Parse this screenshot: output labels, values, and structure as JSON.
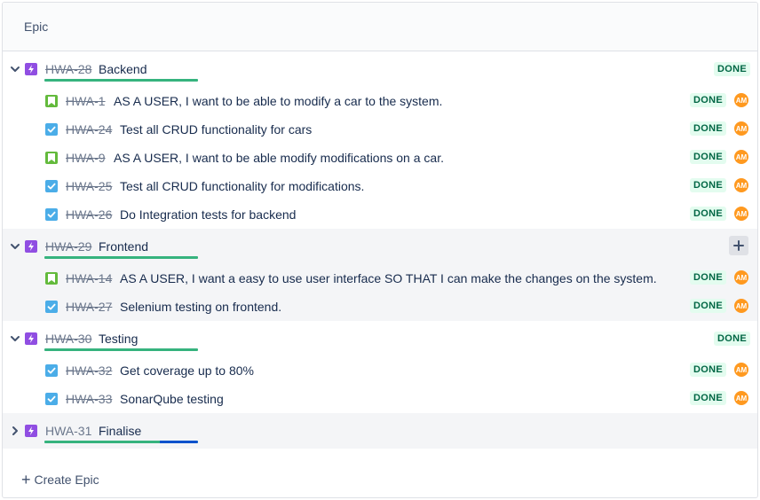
{
  "header": {
    "label": "Epic"
  },
  "colors": {
    "done_bar": "#36b37e",
    "in_progress_bar": "#0052cc",
    "epic_icon": "#904ee2",
    "story_icon": "#63ba3c",
    "task_icon": "#4bade8",
    "avatar": "#ff991f"
  },
  "epics": [
    {
      "key": "HWA-28",
      "title": "Backend",
      "status": "DONE",
      "done": true,
      "expanded": true,
      "progress": {
        "done": 1.0,
        "in_progress": 0.0
      },
      "issues": [
        {
          "key": "HWA-1",
          "type": "story",
          "title": "AS A USER, I want to be able to modify a car to the system.",
          "status": "DONE",
          "assignee": "AM"
        },
        {
          "key": "HWA-24",
          "type": "task",
          "title": "Test all CRUD functionality for cars",
          "status": "DONE",
          "assignee": "AM"
        },
        {
          "key": "HWA-9",
          "type": "story",
          "title": "AS A USER, I want to be able modify modifications on a car.",
          "status": "DONE",
          "assignee": "AM"
        },
        {
          "key": "HWA-25",
          "type": "task",
          "title": "Test all CRUD functionality for modifications.",
          "status": "DONE",
          "assignee": "AM"
        },
        {
          "key": "HWA-26",
          "type": "task",
          "title": "Do Integration tests for backend",
          "status": "DONE",
          "assignee": "AM"
        }
      ]
    },
    {
      "key": "HWA-29",
      "title": "Frontend",
      "status": "",
      "done": true,
      "expanded": true,
      "progress": {
        "done": 1.0,
        "in_progress": 0.0
      },
      "issues": [
        {
          "key": "HWA-14",
          "type": "story",
          "title": "AS A USER, I want a easy to use user interface SO THAT I can make the changes on the system.",
          "status": "DONE",
          "assignee": "AM"
        },
        {
          "key": "HWA-27",
          "type": "task",
          "title": "Selenium testing on frontend.",
          "status": "DONE",
          "assignee": "AM"
        }
      ]
    },
    {
      "key": "HWA-30",
      "title": "Testing",
      "status": "DONE",
      "done": true,
      "expanded": true,
      "progress": {
        "done": 1.0,
        "in_progress": 0.0
      },
      "issues": [
        {
          "key": "HWA-32",
          "type": "task",
          "title": "Get coverage up to 80%",
          "status": "DONE",
          "assignee": "AM"
        },
        {
          "key": "HWA-33",
          "type": "task",
          "title": "SonarQube testing",
          "status": "DONE",
          "assignee": "AM"
        }
      ]
    },
    {
      "key": "HWA-31",
      "title": "Finalise",
      "status": "",
      "done": false,
      "expanded": false,
      "progress": {
        "done": 0.75,
        "in_progress": 0.25
      },
      "issues": []
    }
  ],
  "footer": {
    "create_label": "Create Epic"
  }
}
